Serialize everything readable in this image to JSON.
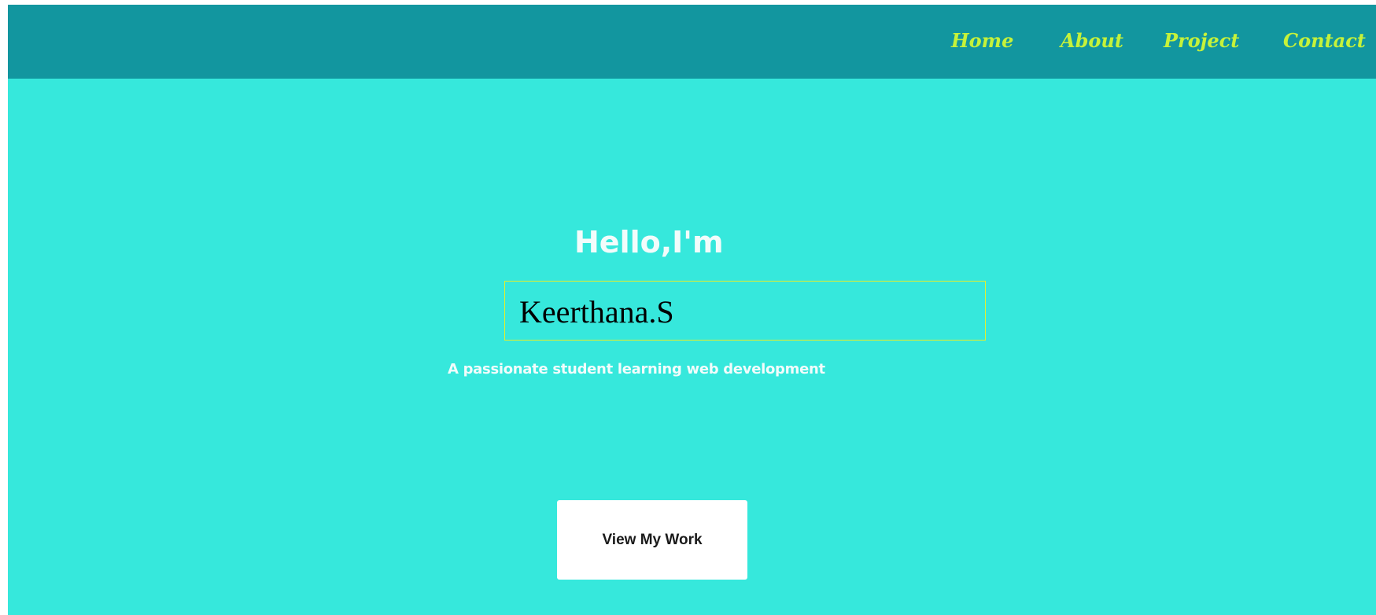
{
  "nav": {
    "items": [
      {
        "label": "Home"
      },
      {
        "label": "About"
      },
      {
        "label": "Project"
      },
      {
        "label": "Contact"
      }
    ]
  },
  "hero": {
    "greeting": "Hello,I'm",
    "name": "Keerthana.S",
    "tagline": "A passionate student learning web development",
    "cta_label": "View My Work"
  },
  "colors": {
    "background": "#36e8dc",
    "navbar": "#12969f",
    "nav_link": "#c6f23a",
    "name_box_border": "#e6ef2a",
    "hero_text": "#f2fcfb",
    "button_bg": "#ffffff"
  }
}
